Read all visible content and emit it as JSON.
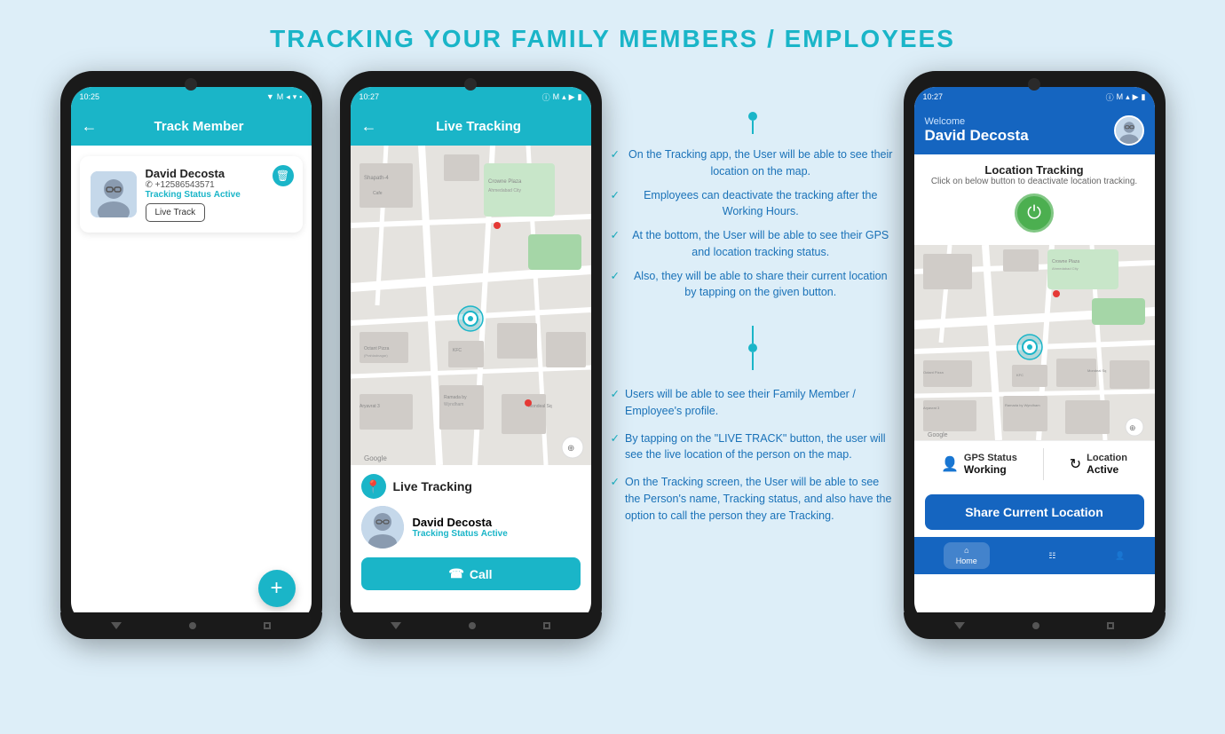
{
  "page": {
    "title": "TRACKING YOUR FAMILY MEMBERS / EMPLOYEES",
    "background": "#ddeef8"
  },
  "phone1": {
    "statusBar": {
      "time": "10:25",
      "icons": "▼ M ◂ ▾ ◼"
    },
    "navTitle": "Track Member",
    "member": {
      "name": "David Decosta",
      "phone": "+12586543571",
      "status": "Tracking Status",
      "statusValue": "Active",
      "liveTrackBtn": "Live Track"
    },
    "fab": "+"
  },
  "phone2": {
    "statusBar": {
      "time": "10:27",
      "icons": "▼ M ◂ ▾ ◼"
    },
    "navTitle": "Live Tracking",
    "liveTracking": {
      "title": "Live Tracking",
      "personName": "David Decosta",
      "statusLabel": "Tracking Status",
      "statusValue": "Active",
      "callBtn": "Call"
    }
  },
  "annotations": {
    "top": [
      "On the Tracking app, the User will be able to see their location on the map.",
      "Employees can deactivate the tracking after the Working Hours.",
      "At the bottom, the User will be able to see their GPS and location tracking status.",
      "Also, they will be able to share their current location by tapping on the given button."
    ],
    "bottom": [
      "Users will be able to see their Family Member / Employee's profile.",
      "By tapping on the \"LIVE TRACK\" button, the user will see the live location of the person on the map.",
      "On the Tracking screen, the User will be able to see the Person's name, Tracking status, and also have the option to call the person they are Tracking."
    ]
  },
  "phone3": {
    "statusBar": {
      "time": "10:27",
      "icons": "▼ M ◂ ▾ ◼"
    },
    "header": {
      "welcome": "Welcome",
      "name": "David Decosta"
    },
    "locationTracking": {
      "title": "Location Tracking",
      "subtitle": "Click on below button to deactivate location tracking."
    },
    "gps": {
      "gpsLabel": "GPS Status",
      "gpsValue": "Working",
      "locationLabel": "Location",
      "locationValue": "Active"
    },
    "shareBtn": "Share Current Location",
    "bottomNav": {
      "home": "Home",
      "list": "",
      "profile": ""
    }
  }
}
